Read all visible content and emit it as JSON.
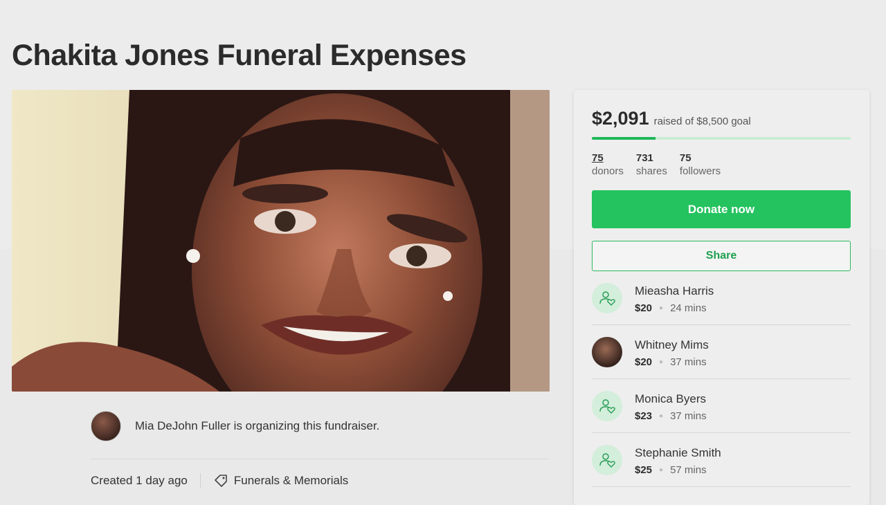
{
  "campaign": {
    "title": "Chakita Jones Funeral Expenses",
    "organizer_text": "Mia DeJohn Fuller is organizing this fundraiser.",
    "created": "Created 1 day ago",
    "category": "Funerals & Memorials"
  },
  "fundraising": {
    "raised": "$2,091",
    "goal_text": "raised of $8,500 goal",
    "progress_fraction": 0.246,
    "stats": [
      {
        "value": "75",
        "label": "donors"
      },
      {
        "value": "731",
        "label": "shares"
      },
      {
        "value": "75",
        "label": "followers"
      }
    ],
    "donate_label": "Donate now",
    "share_label": "Share"
  },
  "donors": [
    {
      "name": "Mieasha Harris",
      "amount": "$20",
      "time": "24 mins",
      "avatar": "heart-person-icon"
    },
    {
      "name": "Whitney Mims",
      "amount": "$20",
      "time": "37 mins",
      "avatar": "photo"
    },
    {
      "name": "Monica Byers",
      "amount": "$23",
      "time": "37 mins",
      "avatar": "heart-person-icon"
    },
    {
      "name": "Stephanie Smith",
      "amount": "$25",
      "time": "57 mins",
      "avatar": "heart-person-icon"
    }
  ],
  "colors": {
    "accent_green": "#24c35f",
    "progress_track": "#c9ecd3",
    "icon_bg": "#d3eedb"
  }
}
